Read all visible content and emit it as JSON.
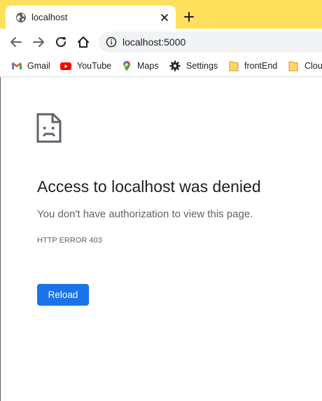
{
  "tab": {
    "title": "localhost",
    "globe_icon": "globe-icon",
    "close_icon": "close-icon",
    "new_tab_icon": "plus-icon"
  },
  "toolbar": {
    "back_icon": "arrow-left-icon",
    "forward_icon": "arrow-right-icon",
    "reload_icon": "reload-icon",
    "home_icon": "home-icon",
    "url": "localhost:5000",
    "info_icon": "info-icon"
  },
  "bookmarks": [
    {
      "label": "Gmail",
      "icon": "gmail-icon"
    },
    {
      "label": "YouTube",
      "icon": "youtube-icon"
    },
    {
      "label": "Maps",
      "icon": "maps-icon"
    },
    {
      "label": "Settings",
      "icon": "gear-icon"
    },
    {
      "label": "frontEnd",
      "icon": "folder-icon"
    },
    {
      "label": "Clou",
      "icon": "folder-icon"
    }
  ],
  "error": {
    "icon": "sad-document-icon",
    "heading": "Access to localhost was denied",
    "description": "You don't have authorization to view this page.",
    "code": "HTTP ERROR 403",
    "reload_label": "Reload"
  },
  "colors": {
    "tab_strip": "#ffe05c",
    "omnibox": "#f1f3f4",
    "button": "#1a73e8",
    "text": "#202124",
    "secondary_text": "#5f6368"
  }
}
